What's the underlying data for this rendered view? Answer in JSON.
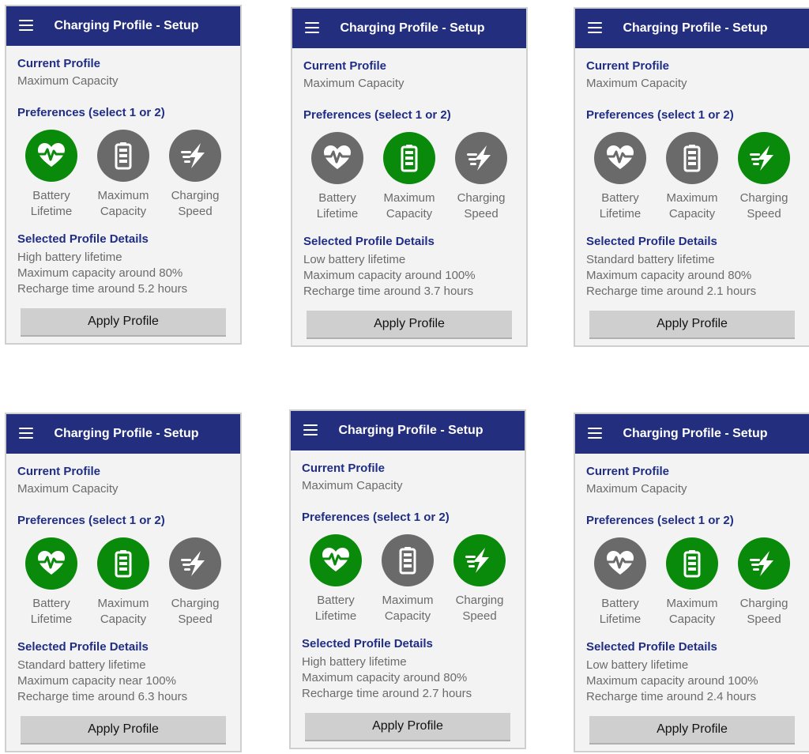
{
  "common": {
    "app_title": "Charging Profile - Setup",
    "current_profile_label": "Current Profile",
    "preferences_label": "Preferences (select 1 or 2)",
    "details_label": "Selected Profile Details",
    "apply_label": "Apply Profile",
    "colors": {
      "appbar": "#232f7e",
      "selected": "#0a8a0a",
      "unselected": "#6a6a6a",
      "heading": "#1f2d86"
    }
  },
  "panels": [
    {
      "current_profile_value": "Maximum Capacity",
      "preferences": [
        {
          "line1": "Battery",
          "line2": "Lifetime",
          "icon": "heart-pulse-icon",
          "selected": true
        },
        {
          "line1": "Maximum",
          "line2": "Capacity",
          "icon": "battery-icon",
          "selected": false
        },
        {
          "line1": "Charging",
          "line2": "Speed",
          "icon": "fast-charge-icon",
          "selected": false
        }
      ],
      "details": [
        "High battery lifetime",
        "Maximum capacity around 80%",
        "Recharge time around 5.2 hours"
      ]
    },
    {
      "current_profile_value": "Maximum Capacity",
      "preferences": [
        {
          "line1": "Battery",
          "line2": "Lifetime",
          "icon": "heart-pulse-icon",
          "selected": false
        },
        {
          "line1": "Maximum",
          "line2": "Capacity",
          "icon": "battery-icon",
          "selected": true
        },
        {
          "line1": "Charging",
          "line2": "Speed",
          "icon": "fast-charge-icon",
          "selected": false
        }
      ],
      "details": [
        "Low battery lifetime",
        "Maximum capacity around 100%",
        "Recharge time around 3.7 hours"
      ]
    },
    {
      "current_profile_value": "Maximum Capacity",
      "preferences": [
        {
          "line1": "Battery",
          "line2": "Lifetime",
          "icon": "heart-pulse-icon",
          "selected": false
        },
        {
          "line1": "Maximum",
          "line2": "Capacity",
          "icon": "battery-icon",
          "selected": false
        },
        {
          "line1": "Charging",
          "line2": "Speed",
          "icon": "fast-charge-icon",
          "selected": true
        }
      ],
      "details": [
        "Standard battery lifetime",
        "Maximum capacity around 80%",
        "Recharge time around 2.1 hours"
      ]
    },
    {
      "current_profile_value": "Maximum Capacity",
      "preferences": [
        {
          "line1": "Battery",
          "line2": "Lifetime",
          "icon": "heart-pulse-icon",
          "selected": true
        },
        {
          "line1": "Maximum",
          "line2": "Capacity",
          "icon": "battery-icon",
          "selected": true
        },
        {
          "line1": "Charging",
          "line2": "Speed",
          "icon": "fast-charge-icon",
          "selected": false
        }
      ],
      "details": [
        "Standard battery lifetime",
        "Maximum capacity near 100%",
        "Recharge time around 6.3 hours"
      ]
    },
    {
      "current_profile_value": "Maximum Capacity",
      "preferences": [
        {
          "line1": "Battery",
          "line2": "Lifetime",
          "icon": "heart-pulse-icon",
          "selected": true
        },
        {
          "line1": "Maximum",
          "line2": "Capacity",
          "icon": "battery-icon",
          "selected": false
        },
        {
          "line1": "Charging",
          "line2": "Speed",
          "icon": "fast-charge-icon",
          "selected": true
        }
      ],
      "details": [
        "High battery lifetime",
        "Maximum capacity around 80%",
        "Recharge time around 2.7 hours"
      ]
    },
    {
      "current_profile_value": "Maximum Capacity",
      "preferences": [
        {
          "line1": "Battery",
          "line2": "Lifetime",
          "icon": "heart-pulse-icon",
          "selected": false
        },
        {
          "line1": "Maximum",
          "line2": "Capacity",
          "icon": "battery-icon",
          "selected": true
        },
        {
          "line1": "Charging",
          "line2": "Speed",
          "icon": "fast-charge-icon",
          "selected": true
        }
      ],
      "details": [
        "Low battery lifetime",
        "Maximum capacity around 100%",
        "Recharge time around 2.4 hours"
      ]
    }
  ]
}
